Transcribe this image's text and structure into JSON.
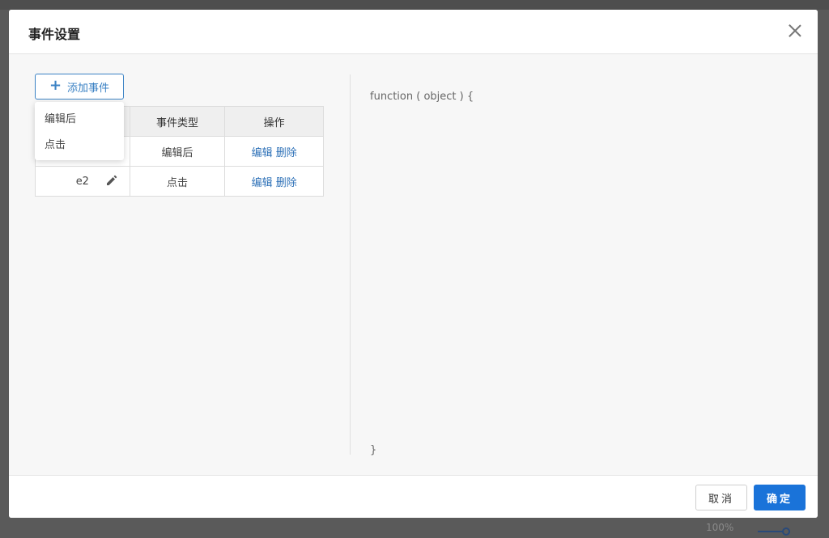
{
  "background": {
    "zoom_label": "100%"
  },
  "modal": {
    "title": "事件设置",
    "add_event_label": "添加事件",
    "dropdown": {
      "items": [
        "编辑后",
        "点击"
      ]
    },
    "table": {
      "headers": [
        "",
        "事件类型",
        "操作"
      ],
      "rows": [
        {
          "name": "",
          "type": "编辑后",
          "edit": "编辑",
          "delete": "删除"
        },
        {
          "name": "e2",
          "type": "点击",
          "edit": "编辑",
          "delete": "删除"
        }
      ]
    },
    "code": {
      "head": "function ( object ) {",
      "tail": "}"
    },
    "footer": {
      "cancel_label": "取消",
      "ok_label": "确定"
    },
    "colors": {
      "accent": "#1a73d9",
      "link": "#2f72b8"
    }
  }
}
